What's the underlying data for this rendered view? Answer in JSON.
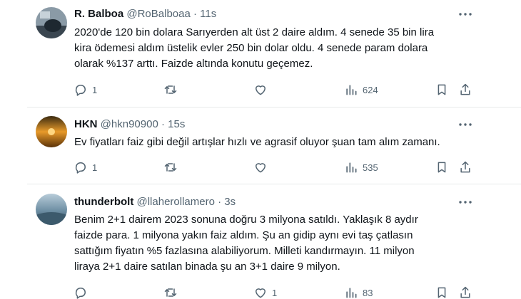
{
  "tweets": [
    {
      "name": "R. Balboa",
      "handle": "@RoBalboaa",
      "separator": "·",
      "time": "11s",
      "lines": [
        "2020'de 120 bin dolara Sarıyerden alt üst 2 daire aldım. 4 senede 35 bin lira",
        "kira ödemesi aldım üstelik evler 250 bin dolar oldu. 4 senede param dolara",
        "olarak %137 arttı. Faizde altında konutu geçemez."
      ],
      "replies": "1",
      "retweets": "",
      "likes": "",
      "views": "624"
    },
    {
      "name": "HKN",
      "handle": "@hkn90900",
      "separator": "·",
      "time": "15s",
      "lines": [
        "Ev fiyatları faiz gibi değil artışlar hızlı ve agrasif oluyor şuan tam alım zamanı."
      ],
      "replies": "1",
      "retweets": "",
      "likes": "",
      "views": "535"
    },
    {
      "name": "thunderbolt",
      "handle": "@llaherollamero",
      "separator": "·",
      "time": "3s",
      "lines": [
        "Benim 2+1 dairem 2023 sonuna doğru 3 milyona satıldı. Yaklaşık 8 aydır",
        "faizde para. 1 milyona yakın faiz aldım. Şu an gidip aynı evi taş çatlasın",
        "sattığım fiyatın %5 fazlasına alabiliyorum. Milleti kandırmayın. 11 milyon",
        "liraya 2+1 daire satılan binada şu an 3+1  daire 9 milyon."
      ],
      "replies": "",
      "retweets": "",
      "likes": "1",
      "views": "83"
    }
  ],
  "colors": {
    "text": "#0f1419",
    "secondary": "#536471",
    "divider": "#e7e9ea"
  },
  "icons": [
    "reply-icon",
    "retweet-icon",
    "like-icon",
    "views-icon",
    "bookmark-icon",
    "share-icon",
    "more-icon"
  ]
}
